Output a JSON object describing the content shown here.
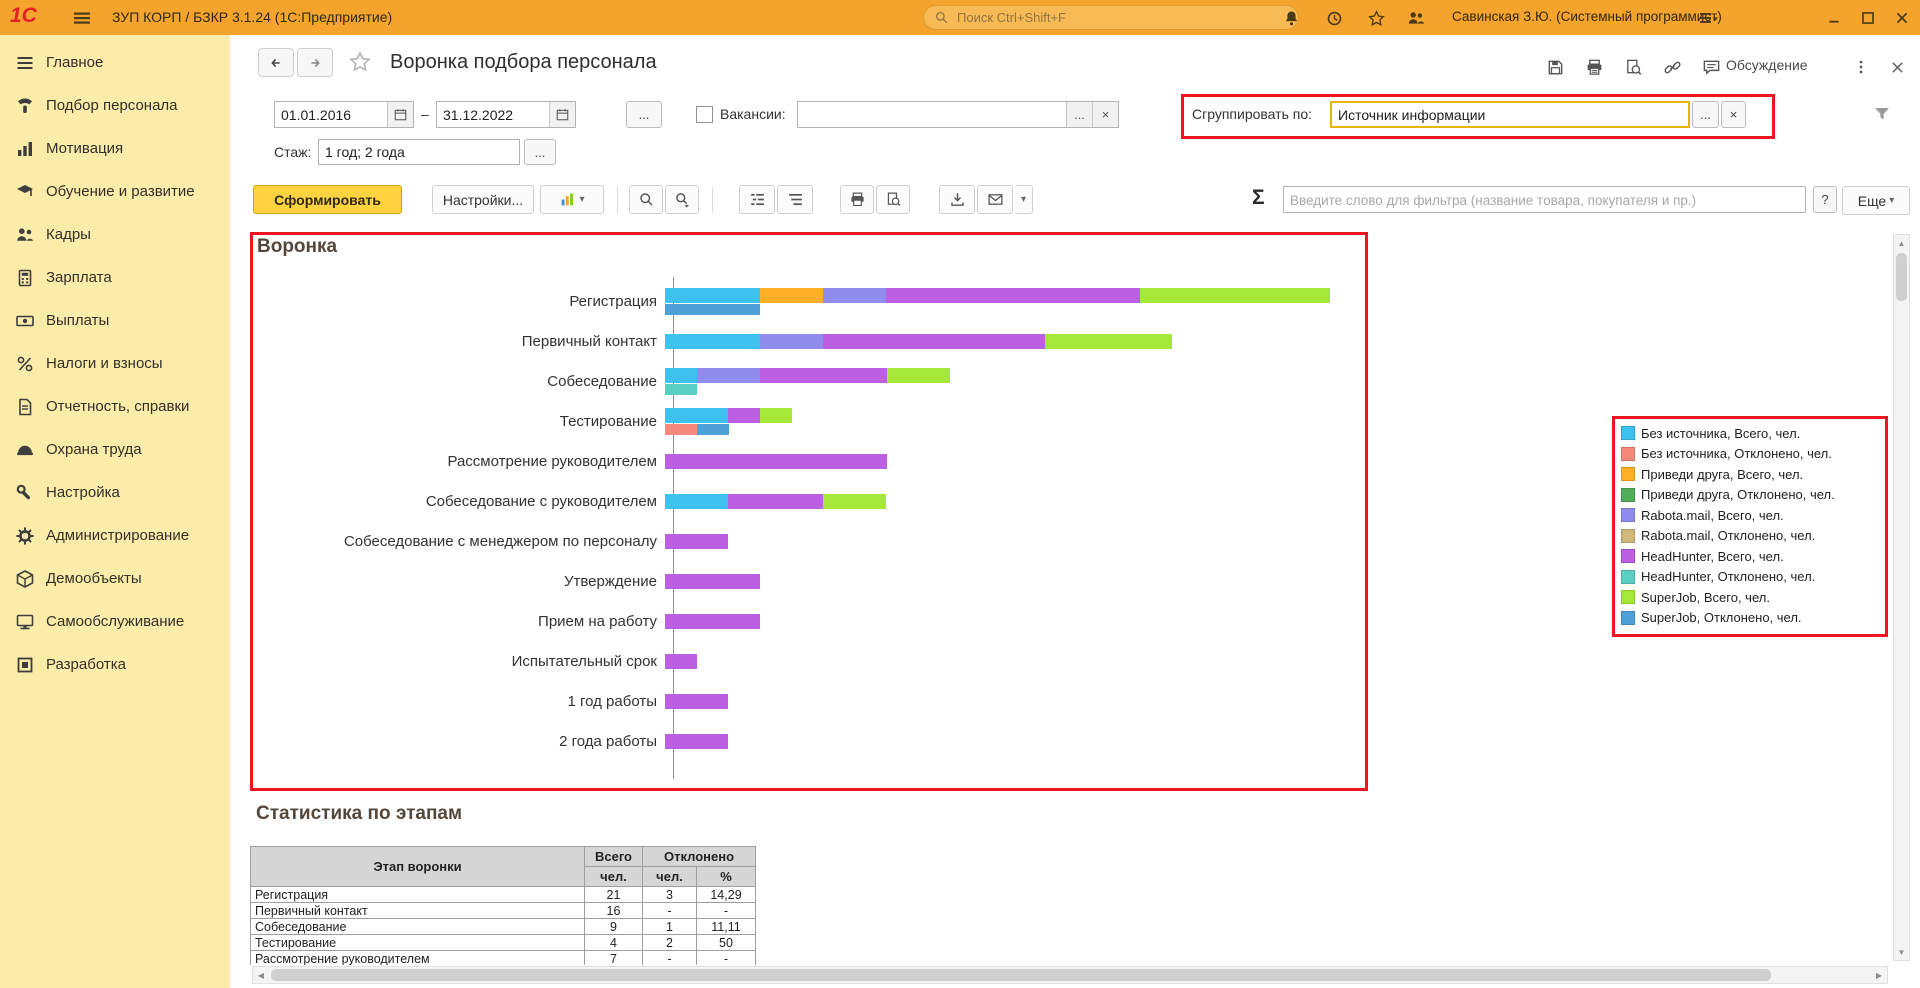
{
  "colors": {
    "topbar": "#f4a42c",
    "sidebar": "#fcecaa",
    "annotation_red": "#ee1420",
    "generate_button": "#ffd23f",
    "group_by_highlight": "#e7b40e"
  },
  "topbar": {
    "logo": "1С",
    "title": "ЗУП КОРП / БЗКР 3.1.24  (1С:Предприятие)",
    "search_placeholder": "Поиск Ctrl+Shift+F",
    "user": "Савинская З.Ю. (Системный программист)"
  },
  "sidebar": {
    "items": [
      {
        "key": "main",
        "icon": "menu",
        "label": "Главное"
      },
      {
        "key": "recruitment",
        "icon": "phone",
        "label": "Подбор персонала"
      },
      {
        "key": "motivation",
        "icon": "chart",
        "label": "Мотивация"
      },
      {
        "key": "training",
        "icon": "education",
        "label": "Обучение и развитие"
      },
      {
        "key": "hr",
        "icon": "people",
        "label": "Кадры"
      },
      {
        "key": "salary",
        "icon": "calculator",
        "label": "Зарплата"
      },
      {
        "key": "payments",
        "icon": "banknote",
        "label": "Выплаты"
      },
      {
        "key": "taxes",
        "icon": "percent",
        "label": "Налоги и взносы"
      },
      {
        "key": "reporting",
        "icon": "document",
        "label": "Отчетность, справки"
      },
      {
        "key": "labor-safety",
        "icon": "helmet",
        "label": "Охрана труда"
      },
      {
        "key": "setup",
        "icon": "wrench",
        "label": "Настройка"
      },
      {
        "key": "administration",
        "icon": "gear",
        "label": "Администрирование"
      },
      {
        "key": "demo-objects",
        "icon": "cube",
        "label": "Демообъекты"
      },
      {
        "key": "self-service",
        "icon": "monitor",
        "label": "Самообслуживание"
      },
      {
        "key": "development",
        "icon": "square",
        "label": "Разработка"
      }
    ]
  },
  "page": {
    "title": "Воронка подбора персонала",
    "discussion_label": "Обсуждение"
  },
  "filters": {
    "date_from": "01.01.2016",
    "date_separator": "–",
    "date_to": "31.12.2022",
    "ellipsis": "...",
    "clear": "×",
    "vacancies_label": "Вакансии:",
    "vacancies_value": "",
    "group_by_label": "Сгруппировать по:",
    "group_by_value": "Источник информации",
    "experience_label": "Стаж:",
    "experience_value": "1 год; 2 года"
  },
  "toolbar": {
    "generate": "Сформировать",
    "settings": "Настройки...",
    "sigma": "Σ",
    "filter_placeholder": "Введите слово для фильтра (название товара, покупателя и пр.)",
    "help": "?",
    "more": "Еще"
  },
  "chart_data": {
    "type": "bar",
    "orientation": "horizontal",
    "stacked": true,
    "title": "Воронка",
    "value_unit": "чел.",
    "xlim": [
      0,
      21
    ],
    "grid": false,
    "legend_position": "right",
    "legend": [
      {
        "key": "no_source_total",
        "label": "Без источника, Всего, чел.",
        "color": "#3fc1ef"
      },
      {
        "key": "no_source_declined",
        "label": "Без источника, Отклонено, чел.",
        "color": "#f4897c"
      },
      {
        "key": "friend_total",
        "label": "Приведи друга, Всего, чел.",
        "color": "#ffb026"
      },
      {
        "key": "friend_declined",
        "label": "Приведи друга, Отклонено, чел.",
        "color": "#4fae57"
      },
      {
        "key": "rabota_total",
        "label": "Rabota.mail, Всего, чел.",
        "color": "#8f8cee"
      },
      {
        "key": "rabota_declined",
        "label": "Rabota.mail, Отклонено, чел.",
        "color": "#cdb97c"
      },
      {
        "key": "hh_total",
        "label": "HeadHunter, Всего, чел.",
        "color": "#bd5fe3"
      },
      {
        "key": "hh_declined",
        "label": "HeadHunter, Отклонено, чел.",
        "color": "#5acfc3"
      },
      {
        "key": "superjob_total",
        "label": "SuperJob, Всего, чел.",
        "color": "#a6e838"
      },
      {
        "key": "superjob_declined",
        "label": "SuperJob, Отклонено, чел.",
        "color": "#4f9fd8"
      }
    ],
    "rows": [
      {
        "label": "Регистрация",
        "total": [
          {
            "key": "no_source_total",
            "value": 3
          },
          {
            "key": "friend_total",
            "value": 2
          },
          {
            "key": "rabota_total",
            "value": 2
          },
          {
            "key": "hh_total",
            "value": 8
          },
          {
            "key": "superjob_total",
            "value": 6
          }
        ],
        "declined": [
          {
            "key": "superjob_declined",
            "value": 3
          }
        ]
      },
      {
        "label": "Первичный контакт",
        "total": [
          {
            "key": "no_source_total",
            "value": 3
          },
          {
            "key": "rabota_total",
            "value": 2
          },
          {
            "key": "hh_total",
            "value": 7
          },
          {
            "key": "superjob_total",
            "value": 4
          }
        ],
        "declined": []
      },
      {
        "label": "Собеседование",
        "total": [
          {
            "key": "no_source_total",
            "value": 1
          },
          {
            "key": "rabota_total",
            "value": 2
          },
          {
            "key": "hh_total",
            "value": 4
          },
          {
            "key": "superjob_total",
            "value": 2
          }
        ],
        "declined": [
          {
            "key": "hh_declined",
            "value": 1
          }
        ]
      },
      {
        "label": "Тестирование",
        "total": [
          {
            "key": "no_source_total",
            "value": 2
          },
          {
            "key": "hh_total",
            "value": 1
          },
          {
            "key": "superjob_total",
            "value": 1
          }
        ],
        "declined": [
          {
            "key": "no_source_declined",
            "value": 1
          },
          {
            "key": "superjob_declined",
            "value": 1
          }
        ]
      },
      {
        "label": "Рассмотрение руководителем",
        "total": [
          {
            "key": "hh_total",
            "value": 7
          }
        ],
        "declined": []
      },
      {
        "label": "Собеседование с руководителем",
        "total": [
          {
            "key": "no_source_total",
            "value": 2
          },
          {
            "key": "hh_total",
            "value": 3
          },
          {
            "key": "superjob_total",
            "value": 2
          }
        ],
        "declined": []
      },
      {
        "label": "Собеседование с менеджером по персоналу",
        "total": [
          {
            "key": "hh_total",
            "value": 2
          }
        ],
        "declined": []
      },
      {
        "label": "Утверждение",
        "total": [
          {
            "key": "hh_total",
            "value": 3
          }
        ],
        "declined": []
      },
      {
        "label": "Прием на работу",
        "total": [
          {
            "key": "hh_total",
            "value": 3
          }
        ],
        "declined": []
      },
      {
        "label": "Испытательный срок",
        "total": [
          {
            "key": "hh_total",
            "value": 1
          }
        ],
        "declined": []
      },
      {
        "label": "1 год работы",
        "total": [
          {
            "key": "hh_total",
            "value": 2
          }
        ],
        "declined": []
      },
      {
        "label": "2 года работы",
        "total": [
          {
            "key": "hh_total",
            "value": 2
          }
        ],
        "declined": []
      }
    ]
  },
  "stats": {
    "title": "Статистика по этапам",
    "table": {
      "stage_header": "Этап воронки",
      "total_header": "Всего",
      "declined_header": "Отклонено",
      "unit_label": "чел.",
      "percent_label": "%",
      "rows": [
        {
          "stage": "Регистрация",
          "total": "21",
          "declined": "3",
          "percent": "14,29"
        },
        {
          "stage": "Первичный контакт",
          "total": "16",
          "declined": "-",
          "percent": "-"
        },
        {
          "stage": "Собеседование",
          "total": "9",
          "declined": "1",
          "percent": "11,11"
        },
        {
          "stage": "Тестирование",
          "total": "4",
          "declined": "2",
          "percent": "50"
        },
        {
          "stage": "Рассмотрение руководителем",
          "total": "7",
          "declined": "-",
          "percent": "-"
        }
      ]
    }
  }
}
